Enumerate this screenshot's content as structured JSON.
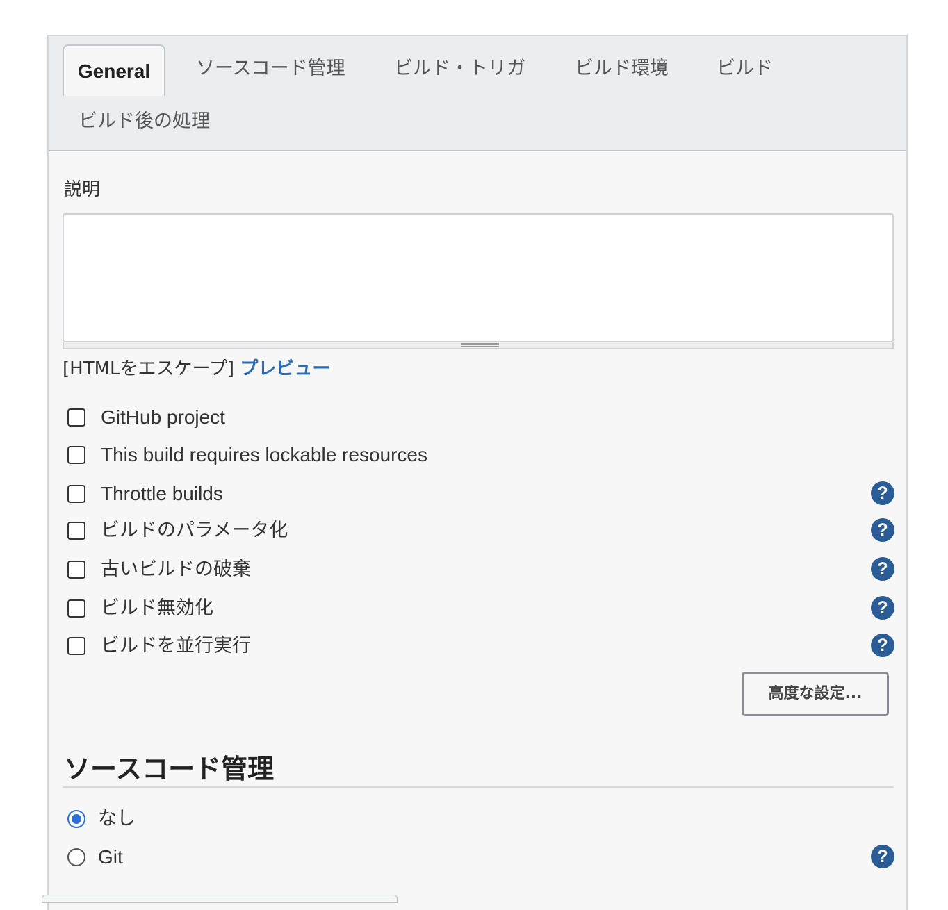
{
  "tabs": [
    {
      "label": "General",
      "active": true
    },
    {
      "label": "ソースコード管理"
    },
    {
      "label": "ビルド・トリガ"
    },
    {
      "label": "ビルド環境"
    },
    {
      "label": "ビルド"
    },
    {
      "label": "ビルド後の処理"
    }
  ],
  "description": {
    "label": "説明",
    "value": "",
    "escape_text": "[HTMLをエスケープ]",
    "preview_link": "プレビュー"
  },
  "options": [
    {
      "label": "GitHub project",
      "checked": false,
      "help": false
    },
    {
      "label": "This build requires lockable resources",
      "checked": false,
      "help": false
    },
    {
      "label": "Throttle builds",
      "checked": false,
      "help": true
    },
    {
      "label": "ビルドのパラメータ化",
      "checked": false,
      "help": true
    },
    {
      "label": "古いビルドの破棄",
      "checked": false,
      "help": true
    },
    {
      "label": "ビルド無効化",
      "checked": false,
      "help": true
    },
    {
      "label": "ビルドを並行実行",
      "checked": false,
      "help": true
    }
  ],
  "help_glyph": "?",
  "advanced_button": "高度な設定...",
  "scm": {
    "title": "ソースコード管理",
    "options": [
      {
        "label": "なし",
        "selected": true
      },
      {
        "label": "Git",
        "selected": false
      }
    ]
  },
  "colors": {
    "link": "#2a6cba",
    "help_icon": "#2a5d95",
    "radio_selected": "#2c6fd6",
    "tabbar_bg": "#ebeef1"
  }
}
